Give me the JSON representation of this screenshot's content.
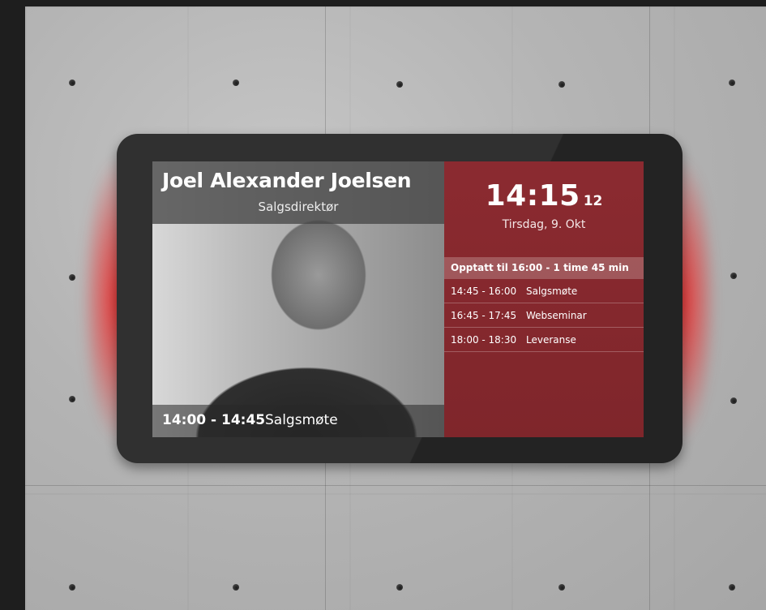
{
  "person": {
    "name": "Joel Alexander Joelsen",
    "title": "Salgsdirektør"
  },
  "current_meeting": {
    "time": "14:00 - 14:45",
    "name": "Salgsmøte"
  },
  "clock": {
    "time": "14:15",
    "seconds": "12",
    "date": "Tirsdag, 9. Okt"
  },
  "status": {
    "text": "Opptatt til 16:00 - 1 time 45 min"
  },
  "schedule": [
    {
      "time": "14:45 - 16:00",
      "name": "Salgsmøte"
    },
    {
      "time": "16:45 - 17:45",
      "name": "Webseminar"
    },
    {
      "time": "18:00 - 18:30",
      "name": "Leveranse"
    }
  ],
  "colors": {
    "accent": "#8b2a30",
    "glow": "#eb2828",
    "bezel": "#232323"
  }
}
